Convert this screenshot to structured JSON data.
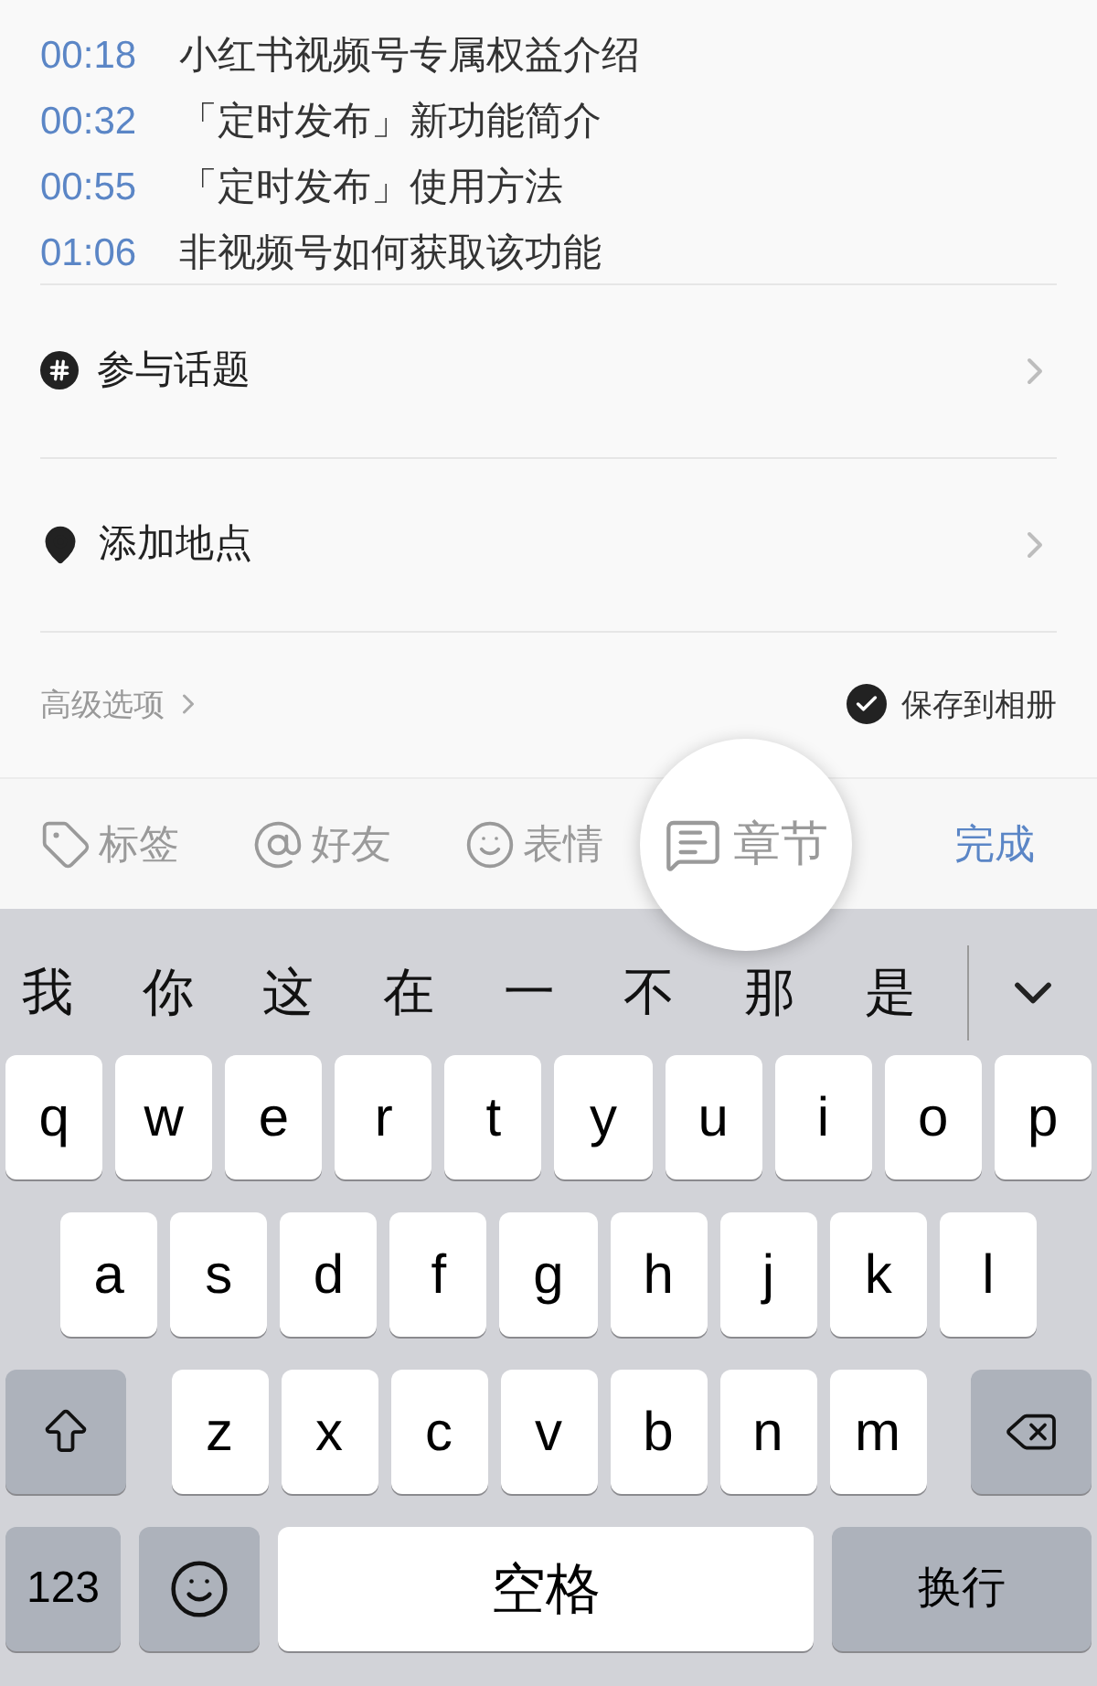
{
  "chapters": [
    {
      "time": "00:18",
      "title": "小红书视频号专属权益介绍"
    },
    {
      "time": "00:32",
      "title": "「定时发布」新功能简介"
    },
    {
      "time": "00:55",
      "title": "「定时发布」使用方法"
    },
    {
      "time": "01:06",
      "title": "非视频号如何获取该功能"
    }
  ],
  "options": [
    {
      "kind": "topic",
      "label": "参与话题"
    },
    {
      "kind": "location",
      "label": "添加地点"
    }
  ],
  "advanced": {
    "label": "高级选项"
  },
  "save_to_album": {
    "label": "保存到相册",
    "checked": true
  },
  "tools": [
    {
      "kind": "tag",
      "label": "标签",
      "magnified": false
    },
    {
      "kind": "mention",
      "label": "好友",
      "magnified": false
    },
    {
      "kind": "emoji",
      "label": "表情",
      "magnified": false
    },
    {
      "kind": "chapter",
      "label": "章节",
      "magnified": true
    }
  ],
  "done": "完成",
  "candidates": [
    "我",
    "你",
    "这",
    "在",
    "一",
    "不",
    "那",
    "是"
  ],
  "key_rows": [
    [
      "q",
      "w",
      "e",
      "r",
      "t",
      "y",
      "u",
      "i",
      "o",
      "p"
    ],
    [
      "a",
      "s",
      "d",
      "f",
      "g",
      "h",
      "j",
      "k",
      "l"
    ],
    [
      "z",
      "x",
      "c",
      "v",
      "b",
      "n",
      "m"
    ]
  ],
  "bottom_keys": {
    "numbers": "123",
    "space": "空格",
    "return": "换行"
  }
}
